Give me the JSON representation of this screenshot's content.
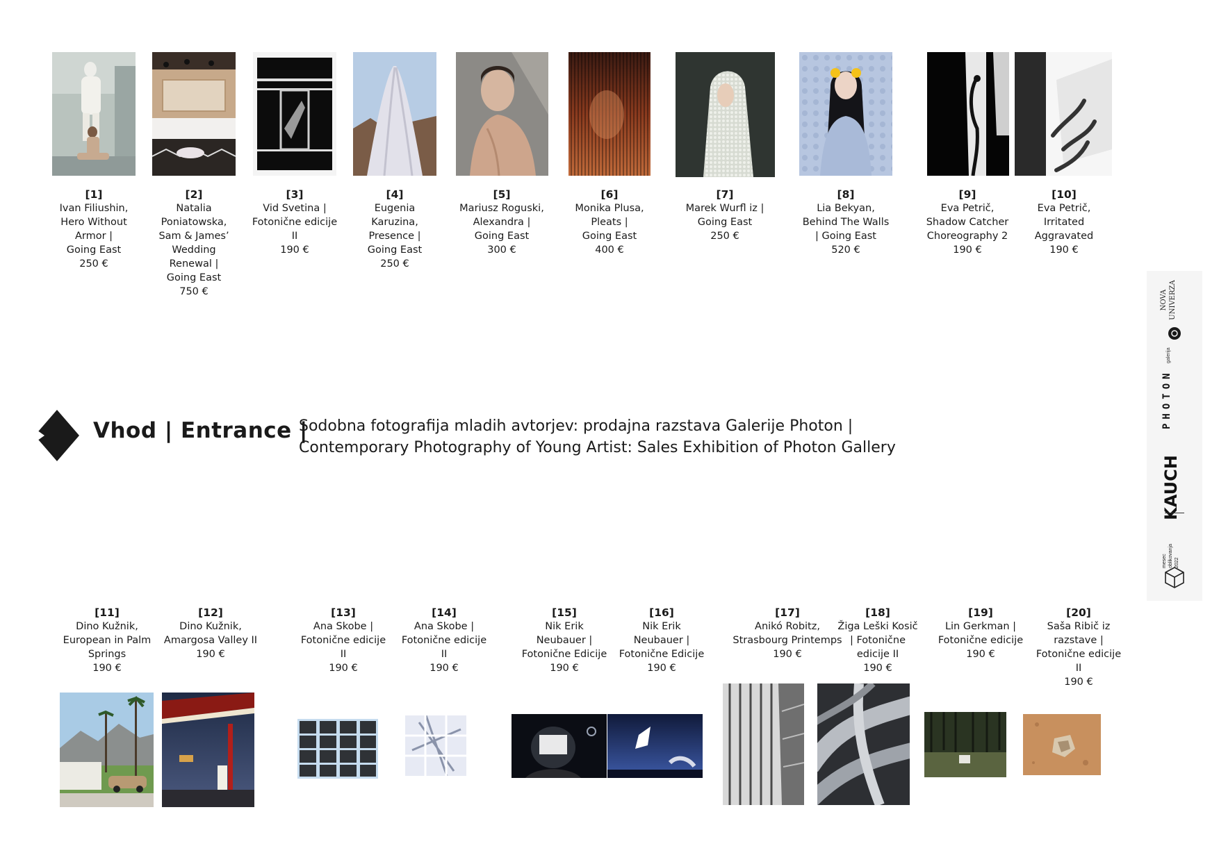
{
  "works_top": [
    {
      "id": "[1]",
      "lines": [
        "Ivan Filiushin,",
        "Hero Without",
        "Armor |",
        "Going East",
        "250 €"
      ],
      "image": "statue-and-woman"
    },
    {
      "id": "[2]",
      "lines": [
        "Natalia",
        "Poniatowska,",
        "Sam & James’",
        "Wedding",
        "Renewal |",
        "Going East",
        "750 €"
      ],
      "image": "banquet-hall"
    },
    {
      "id": "[3]",
      "lines": [
        "Vid Svetina |",
        "Fotonične edicije",
        "II",
        "190 €"
      ],
      "image": "black-abstract"
    },
    {
      "id": "[4]",
      "lines": [
        "Eugenia",
        "Karuzina,",
        "Presence |",
        "Going East",
        "250 €"
      ],
      "image": "veiled-figure"
    },
    {
      "id": "[5]",
      "lines": [
        "Mariusz Roguski,",
        "Alexandra |",
        "Going East",
        "300 €"
      ],
      "image": "woman-portrait"
    },
    {
      "id": "[6]",
      "lines": [
        "Monika Plusa,",
        "Pleats |",
        "Going East",
        "400 €"
      ],
      "image": "pleated-red"
    },
    {
      "id": "[7]",
      "lines": [
        "Marek Wurfl iz |",
        "Going East",
        "250 €"
      ],
      "image": "textured-hood"
    },
    {
      "id": "[8]",
      "lines": [
        "Lia Bekyan,",
        "Behind The Walls",
        "| Going East",
        "520 €"
      ],
      "image": "woman-lemons"
    },
    {
      "id": "[9]",
      "lines": [
        "Eva Petrič,",
        "Shadow Catcher",
        "Choreography 2",
        "190 €"
      ],
      "image": "shadow-dark"
    },
    {
      "id": "[10]",
      "lines": [
        "Eva Petrič,",
        "Irritated",
        "Aggravated",
        "190 €"
      ],
      "image": "shadow-light"
    }
  ],
  "entrance": {
    "title": "Vhod | Entrance |",
    "line1": "Sodobna fotografija mladih avtorjev: prodajna razstava Galerije Photon |",
    "line2": "Contemporary Photography of Young Artist: Sales Exhibition of Photon Gallery"
  },
  "works_bottom": [
    {
      "id": "[11]",
      "lines": [
        "Dino Kužnik,",
        "European in Palm",
        "Springs",
        "190 €"
      ],
      "image": "palm-springs"
    },
    {
      "id": "[12]",
      "lines": [
        "Dino Kužnik,",
        "Amargosa Valley II",
        "190 €"
      ],
      "image": "gas-station"
    },
    {
      "id": "[13]",
      "lines": [
        "Ana Skobe |",
        "Fotonične edicije",
        "II",
        "190 €"
      ],
      "image": "building-grid-dark"
    },
    {
      "id": "[14]",
      "lines": [
        "Ana Skobe |",
        "Fotonične edicije",
        "II",
        "190 €"
      ],
      "image": "building-grid-light"
    },
    {
      "id": "[15]",
      "lines": [
        "Nik Erik",
        "Neubauer |",
        "Fotonične Edicije",
        "190 €"
      ],
      "image": "night-helmet"
    },
    {
      "id": "[16]",
      "lines": [
        "Nik Erik",
        "Neubauer |",
        "Fotonične Edicije",
        "190 €"
      ],
      "image": "night-plane"
    },
    {
      "id": "[17]",
      "lines": [
        "Anikó Robitz,",
        "Strasbourg Printemps",
        "190 €"
      ],
      "image": "facade-lines"
    },
    {
      "id": "[18]",
      "lines": [
        "Žiga Leški Kosič",
        "| Fotonične",
        "edicije II",
        "190 €"
      ],
      "image": "metal-pipes"
    },
    {
      "id": "[19]",
      "lines": [
        "Lin Gerkman |",
        "Fotonične edicije",
        "190 €"
      ],
      "image": "forest-floor"
    },
    {
      "id": "[20]",
      "lines": [
        "Saša Ribič iz",
        "razstave |",
        "Fotonične edicije",
        "II",
        "190 €"
      ],
      "image": "sand-rock"
    }
  ],
  "sponsors": {
    "nova_line1": "NOVA",
    "nova_line2": "UNIVERZA",
    "photon": "PHOTON",
    "photon_sub": "galerija",
    "kauch": "KAUCH",
    "mesec_line1": "mesec",
    "mesec_line2": "oblikovanja",
    "mesec_line3": "2022"
  }
}
